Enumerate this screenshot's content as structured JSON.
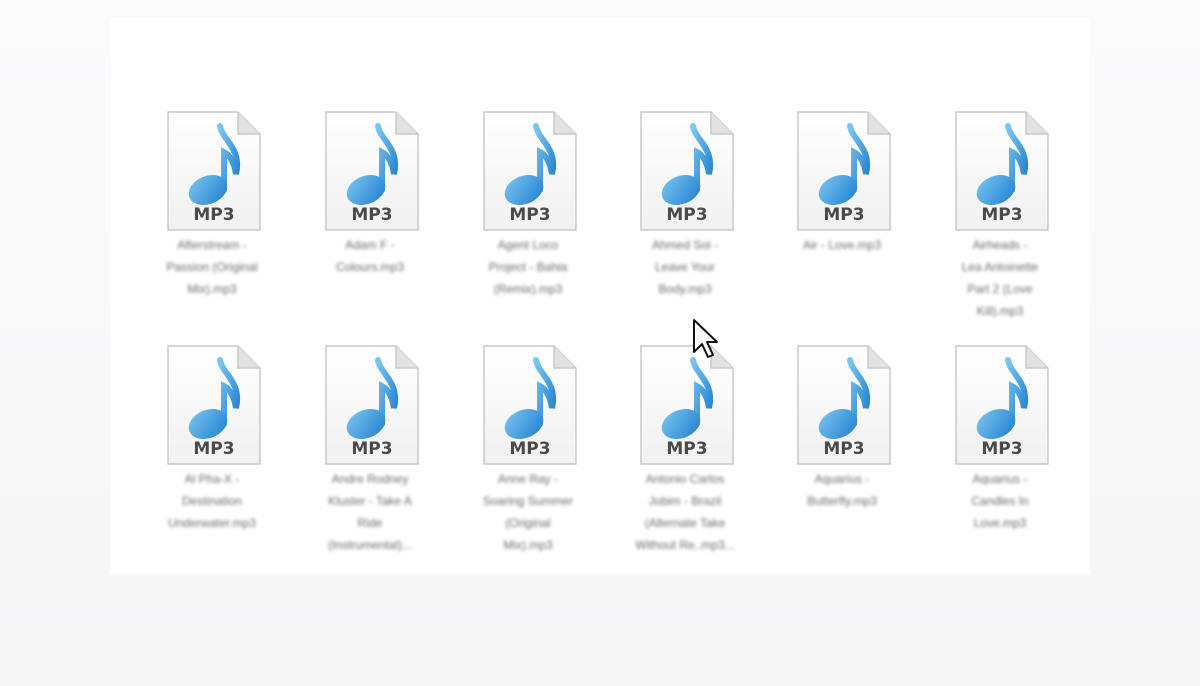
{
  "window": {
    "background": "#ffffff"
  },
  "files": [
    {
      "badge": "MP3",
      "name_lines": [
        "Afterstream -",
        "Passion (Original",
        "Mix).mp3"
      ]
    },
    {
      "badge": "MP3",
      "name_lines": [
        "Adam F -",
        "Colours.mp3"
      ]
    },
    {
      "badge": "MP3",
      "name_lines": [
        "Agent Loco",
        "Project - Bahia",
        "(Remix).mp3"
      ]
    },
    {
      "badge": "MP3",
      "name_lines": [
        "Ahmed Sol -",
        "Leave Your",
        "Body.mp3"
      ]
    },
    {
      "badge": "MP3",
      "name_lines": [
        "Air - Love.mp3"
      ]
    },
    {
      "badge": "MP3",
      "name_lines": [
        "Airheads -",
        "Lea Antoinette",
        "Part 2 (Love",
        "Kill).mp3"
      ]
    },
    {
      "badge": "MP3",
      "name_lines": [
        "Al Pha-X -",
        "Destination",
        "Underwater.mp3"
      ]
    },
    {
      "badge": "MP3",
      "name_lines": [
        "Andre Rodney",
        "Kluster - Take A",
        "Ride",
        "(Instrumental)..."
      ]
    },
    {
      "badge": "MP3",
      "name_lines": [
        "Anne Ray -",
        "Soaring Summer",
        "(Original",
        "Mix).mp3"
      ]
    },
    {
      "badge": "MP3",
      "name_lines": [
        "Antonio Carlos",
        "Jobim - Brazil",
        "(Alternate Take",
        "Without Re..mp3..."
      ]
    },
    {
      "badge": "MP3",
      "name_lines": [
        "Aquarius -",
        "Butterfly.mp3"
      ]
    },
    {
      "badge": "MP3",
      "name_lines": [
        "Aquarius -",
        "Candles In",
        "Love.mp3"
      ]
    }
  ],
  "colors": {
    "note_light": "#7cc6f2",
    "note_dark": "#1f7fcf",
    "badge_text": "#4a4a4a",
    "page_fold": "#e2e2e2"
  },
  "cursor_icon": "arrow-pointer-icon"
}
